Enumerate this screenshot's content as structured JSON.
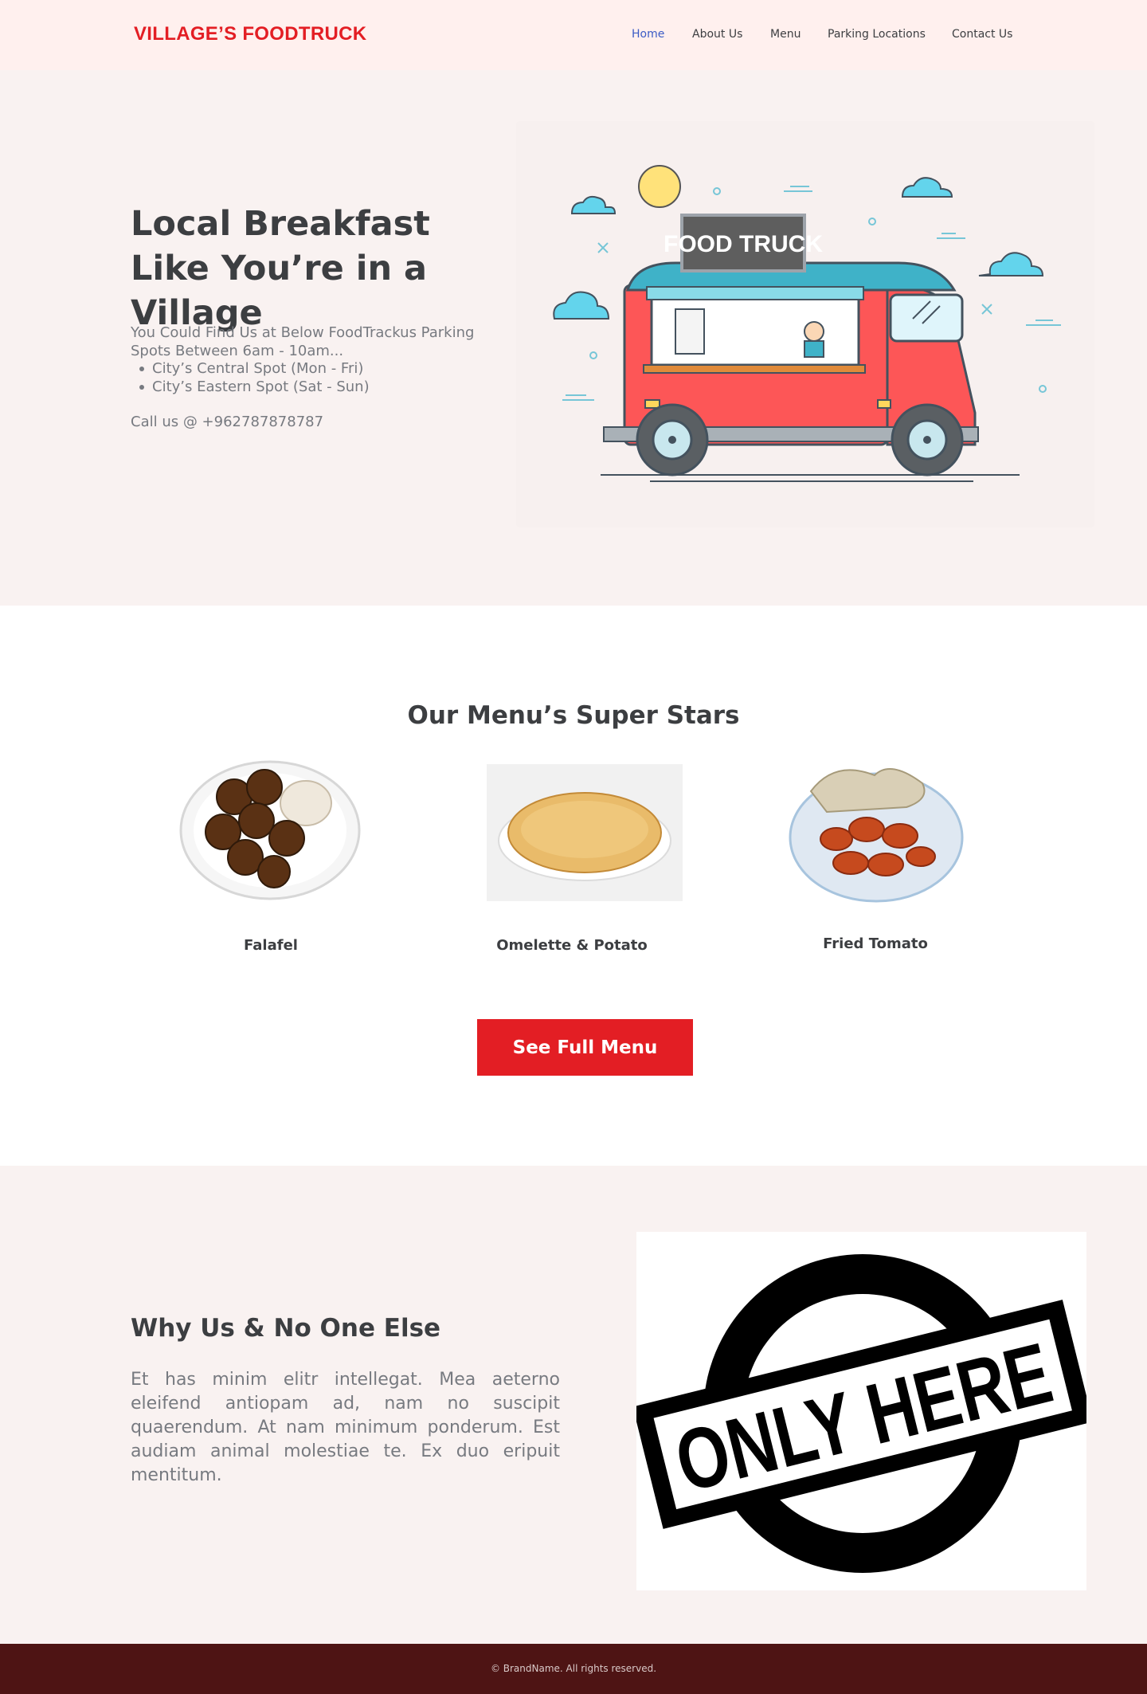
{
  "navbar": {
    "brand": "VILLAGE’S FOODTRUCK",
    "links": [
      {
        "label": "Home",
        "active": true
      },
      {
        "label": "About Us",
        "active": false
      },
      {
        "label": "Menu",
        "active": false
      },
      {
        "label": "Parking Locations",
        "active": false
      },
      {
        "label": "Contact Us",
        "active": false
      }
    ]
  },
  "hero": {
    "title": "Local Breakfast Like You’re in a Village",
    "intro": "You Could Find Us at Below FoodTrackus Parking Spots Between 6am - 10am...",
    "spots": [
      "City’s Central Spot (Mon - Fri)",
      "City’s Eastern Spot (Sat - Sun)"
    ],
    "call": "Call us @ +962787878787",
    "truck_sign": "FOOD TRUCK"
  },
  "menu": {
    "title": "Our Menu’s Super Stars",
    "items": [
      {
        "name": "Falafel"
      },
      {
        "name": "Omelette & Potato"
      },
      {
        "name": "Fried Tomato"
      }
    ],
    "cta": "See Full Menu"
  },
  "why": {
    "title": "Why Us & No One Else",
    "text": "Et has minim elitr intellegat. Mea aeterno eleifend antiopam ad, nam no suscipit quaerendum. At nam minimum ponderum. Est audiam animal molestiae te. Ex duo eripuit mentitum.",
    "stamp_text": "ONLY HERE"
  },
  "footer": {
    "copyright": "© BrandName. All rights reserved."
  },
  "colors": {
    "brand_red": "#e31e24",
    "active_link": "#3b5cc5",
    "hero_bg": "#f9f2f1",
    "nav_bg": "#fff0ee",
    "footer_bg": "#4e1414"
  }
}
